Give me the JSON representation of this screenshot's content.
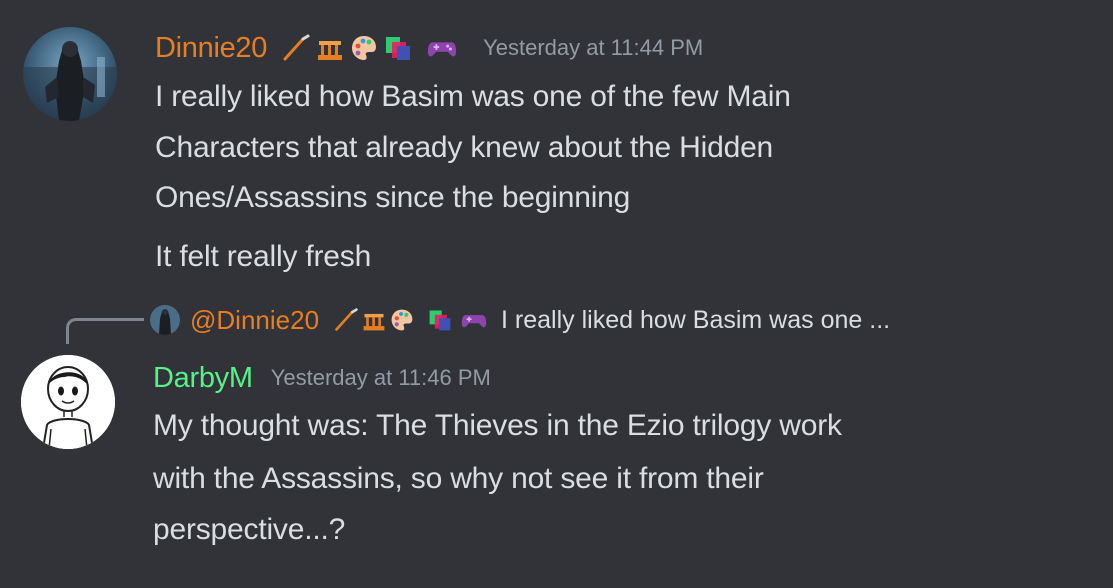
{
  "messages": [
    {
      "username": "Dinnie20",
      "username_color": "#e67e22",
      "badges": [
        "paintbrush-icon",
        "construction-icon",
        "palette-icon",
        "cards-stack-icon",
        "gamepad-icon"
      ],
      "timestamp": "Yesterday at 11:44 PM",
      "lines": [
        "I really liked how Basim was one of the few Main",
        "Characters that already knew about the Hidden",
        "Ones/Assassins since the beginning",
        "It felt really fresh"
      ]
    },
    {
      "reply": {
        "username": "@Dinnie20",
        "preview": "I really liked how Basim was one ..."
      },
      "username": "DarbyM",
      "username_color": "#57f287",
      "timestamp": "Yesterday at 11:46 PM",
      "lines": [
        "My thought was:  The Thieves in the Ezio trilogy work",
        "with the Assassins, so why not see it from their",
        "perspective...?"
      ]
    }
  ]
}
